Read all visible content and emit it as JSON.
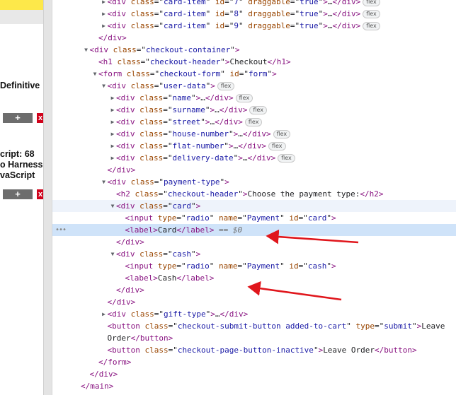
{
  "left_panel": {
    "book1_title": "Definitive",
    "book2_line1": "cript: 68",
    "book2_line2": "o Harness",
    "book2_line3": "vaScript",
    "add_label": "+",
    "remove_label": "x"
  },
  "elements": {
    "badge_flex": "flex",
    "ellipsis": "…",
    "selected_marker": "== $0",
    "gutter_dots": "•••",
    "rows": [
      {
        "depth": 5,
        "tri": "closed",
        "tag": "div",
        "attrs": [
          [
            "class",
            "card-item"
          ],
          [
            "id",
            "7"
          ],
          [
            "draggable",
            "true"
          ]
        ],
        "collapsed": true,
        "close": "div",
        "badge": true,
        "bg": ""
      },
      {
        "depth": 5,
        "tri": "closed",
        "tag": "div",
        "attrs": [
          [
            "class",
            "card-item"
          ],
          [
            "id",
            "8"
          ],
          [
            "draggable",
            "true"
          ]
        ],
        "collapsed": true,
        "close": "div",
        "badge": true,
        "bg": ""
      },
      {
        "depth": 5,
        "tri": "closed",
        "tag": "div",
        "attrs": [
          [
            "class",
            "card-item"
          ],
          [
            "id",
            "9"
          ],
          [
            "draggable",
            "true"
          ]
        ],
        "collapsed": true,
        "close": "div",
        "badge": true,
        "bg": ""
      },
      {
        "depth": 4,
        "tri": "none",
        "closing": "div"
      },
      {
        "depth": 3,
        "tri": "open",
        "tag": "div",
        "attrs": [
          [
            "class",
            "checkout-container"
          ]
        ]
      },
      {
        "depth": 4,
        "tri": "none",
        "tag": "h1",
        "attrs": [
          [
            "class",
            "checkout-header"
          ]
        ],
        "text": "Checkout",
        "close": "h1"
      },
      {
        "depth": 4,
        "tri": "open",
        "tag": "form",
        "attrs": [
          [
            "class",
            "checkout-form"
          ],
          [
            "id",
            "form"
          ]
        ]
      },
      {
        "depth": 5,
        "tri": "open",
        "tag": "div",
        "attrs": [
          [
            "class",
            "user-data"
          ]
        ],
        "badge": true
      },
      {
        "depth": 6,
        "tri": "closed",
        "tag": "div",
        "attrs": [
          [
            "class",
            "name"
          ]
        ],
        "collapsed": true,
        "close": "div",
        "badge": true
      },
      {
        "depth": 6,
        "tri": "closed",
        "tag": "div",
        "attrs": [
          [
            "class",
            "surname"
          ]
        ],
        "collapsed": true,
        "close": "div",
        "badge": true
      },
      {
        "depth": 6,
        "tri": "closed",
        "tag": "div",
        "attrs": [
          [
            "class",
            "street"
          ]
        ],
        "collapsed": true,
        "close": "div",
        "badge": true
      },
      {
        "depth": 6,
        "tri": "closed",
        "tag": "div",
        "attrs": [
          [
            "class",
            "house-number"
          ]
        ],
        "collapsed": true,
        "close": "div",
        "badge": true
      },
      {
        "depth": 6,
        "tri": "closed",
        "tag": "div",
        "attrs": [
          [
            "class",
            "flat-number"
          ]
        ],
        "collapsed": true,
        "close": "div",
        "badge": true
      },
      {
        "depth": 6,
        "tri": "closed",
        "tag": "div",
        "attrs": [
          [
            "class",
            "delivery-date"
          ]
        ],
        "collapsed": true,
        "close": "div",
        "badge": true
      },
      {
        "depth": 5,
        "tri": "none",
        "closing": "div"
      },
      {
        "depth": 5,
        "tri": "open",
        "tag": "div",
        "attrs": [
          [
            "class",
            "payment-type"
          ]
        ]
      },
      {
        "depth": 6,
        "tri": "none",
        "tag": "h2",
        "attrs": [
          [
            "class",
            "checkout-header"
          ]
        ],
        "text": "Choose the payment type:",
        "close": "h2"
      },
      {
        "depth": 6,
        "tri": "open",
        "tag": "div",
        "attrs": [
          [
            "class",
            "card"
          ]
        ],
        "bg": "hover"
      },
      {
        "depth": 7,
        "tri": "none",
        "tag": "input",
        "attrs": [
          [
            "type",
            "radio"
          ],
          [
            "name",
            "Payment"
          ],
          [
            "id",
            "card"
          ]
        ]
      },
      {
        "depth": 7,
        "tri": "none",
        "tag": "label",
        "attrs": [],
        "text": "Card",
        "close": "label",
        "bg": "selected",
        "marker": true
      },
      {
        "depth": 6,
        "tri": "none",
        "closing": "div"
      },
      {
        "depth": 6,
        "tri": "open",
        "tag": "div",
        "attrs": [
          [
            "class",
            "cash"
          ]
        ]
      },
      {
        "depth": 7,
        "tri": "none",
        "tag": "input",
        "attrs": [
          [
            "type",
            "radio"
          ],
          [
            "name",
            "Payment"
          ],
          [
            "id",
            "cash"
          ]
        ]
      },
      {
        "depth": 7,
        "tri": "none",
        "tag": "label",
        "attrs": [],
        "text": "Cash",
        "close": "label"
      },
      {
        "depth": 6,
        "tri": "none",
        "closing": "div"
      },
      {
        "depth": 5,
        "tri": "none",
        "closing": "div"
      },
      {
        "depth": 5,
        "tri": "closed",
        "tag": "div",
        "attrs": [
          [
            "class",
            "gift-type"
          ]
        ],
        "collapsed": true,
        "close": "div"
      },
      {
        "depth": 5,
        "tri": "none",
        "tag": "button",
        "attrs": [
          [
            "class",
            "checkout-submit-button added-to-cart"
          ],
          [
            "type",
            "submit"
          ]
        ],
        "text": "Leave"
      },
      {
        "depth": 5,
        "tri": "none",
        "plaintext": "Order",
        "closing": "button"
      },
      {
        "depth": 5,
        "tri": "none",
        "tag": "button",
        "attrs": [
          [
            "class",
            "checkout-page-button-inactive"
          ]
        ],
        "text": "Leave Order",
        "close": "button"
      },
      {
        "depth": 4,
        "tri": "none",
        "closing": "form"
      },
      {
        "depth": 3,
        "tri": "none",
        "closing": "div"
      },
      {
        "depth": 2,
        "tri": "none",
        "closing": "main"
      }
    ]
  },
  "colors": {
    "tag": "#881280",
    "attr_name": "#994500",
    "attr_value": "#1a1aa6",
    "selected_row": "#cfe3f9",
    "hover_row": "#eef3fb",
    "arrow": "#e0161c",
    "page_yellow": "#fde84a",
    "remove_red": "#d0021b"
  }
}
